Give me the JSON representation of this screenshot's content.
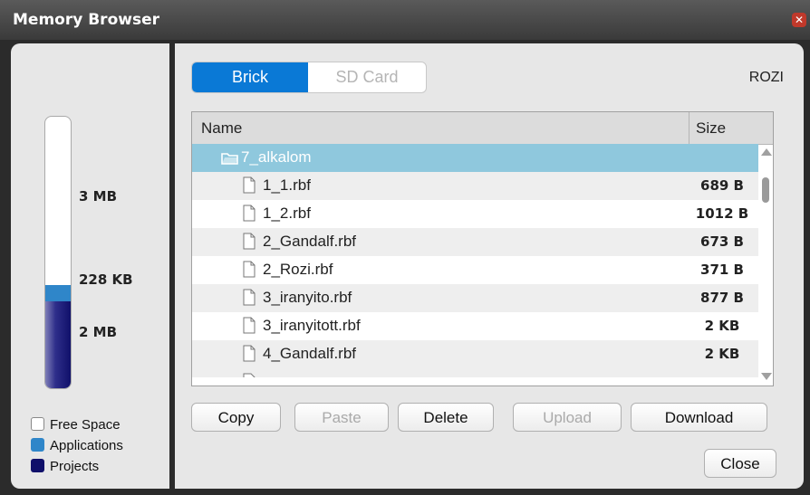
{
  "window": {
    "title": "Memory Browser"
  },
  "storage": {
    "labels": {
      "free": "3 MB",
      "applications": "228 KB",
      "projects": "2 MB"
    },
    "fractions": {
      "applications": 0.06,
      "projects": 0.32
    },
    "colors": {
      "free": "#ffffff",
      "applications": "#2f86c9",
      "projects": "#10106a"
    }
  },
  "legend": [
    {
      "label": "Free Space",
      "color": "#ffffff"
    },
    {
      "label": "Applications",
      "color": "#2f86c9"
    },
    {
      "label": "Projects",
      "color": "#10106a"
    }
  ],
  "tabs": [
    {
      "label": "Brick",
      "active": true
    },
    {
      "label": "SD Card",
      "active": false
    }
  ],
  "brick_name": "ROZI",
  "file_list": {
    "columns": {
      "name": "Name",
      "size": "Size"
    },
    "folder": {
      "name": "7_alkalom",
      "icon": "folder-icon"
    },
    "files": [
      {
        "name": "1_1.rbf",
        "size": "689 B"
      },
      {
        "name": "1_2.rbf",
        "size": "1012 B"
      },
      {
        "name": "2_Gandalf.rbf",
        "size": "673 B"
      },
      {
        "name": "2_Rozi.rbf",
        "size": "371 B"
      },
      {
        "name": "3_iranyito.rbf",
        "size": "877 B"
      },
      {
        "name": "3_iranyitott.rbf",
        "size": "2 KB"
      },
      {
        "name": "4_Gandalf.rbf",
        "size": "2 KB"
      }
    ]
  },
  "buttons": {
    "copy": "Copy",
    "paste": "Paste",
    "delete": "Delete",
    "upload": "Upload",
    "download": "Download",
    "close": "Close"
  },
  "accent": "#0a79d6"
}
